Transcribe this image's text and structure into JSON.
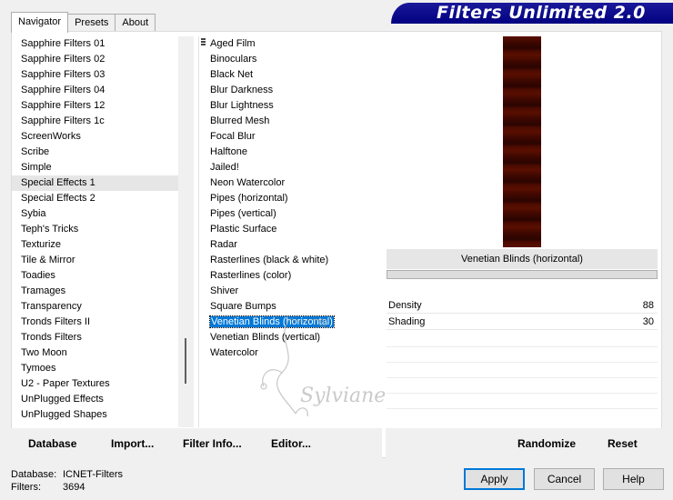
{
  "tabs": [
    {
      "label": "Navigator",
      "active": true
    },
    {
      "label": "Presets",
      "active": false
    },
    {
      "label": "About",
      "active": false
    }
  ],
  "app_title": "Filters Unlimited 2.0",
  "categories": {
    "selected": "Special Effects 1",
    "items": [
      "Sapphire Filters 01",
      "Sapphire Filters 02",
      "Sapphire Filters 03",
      "Sapphire Filters 04",
      "Sapphire Filters 12",
      "Sapphire Filters 1c",
      "ScreenWorks",
      "Scribe",
      "Simple",
      "Special Effects 1",
      "Special Effects 2",
      "Sybia",
      "Teph's Tricks",
      "Texturize",
      "Tile & Mirror",
      "Toadies",
      "Tramages",
      "Transparency",
      "Tronds Filters II",
      "Tronds Filters",
      "Two Moon",
      "Tymoes",
      "U2 - Paper Textures",
      "UnPlugged Effects",
      "UnPlugged Shapes"
    ]
  },
  "filters": {
    "selected": "Venetian Blinds (horizontal)",
    "items": [
      "Aged Film",
      "Binoculars",
      "Black Net",
      "Blur Darkness",
      "Blur Lightness",
      "Blurred Mesh",
      "Focal Blur",
      "Halftone",
      "Jailed!",
      "Neon Watercolor",
      "Pipes (horizontal)",
      "Pipes (vertical)",
      "Plastic Surface",
      "Radar",
      "Rasterlines (black & white)",
      "Rasterlines (color)",
      "Shiver",
      "Square Bumps",
      "Venetian Blinds (horizontal)",
      "Venetian Blinds (vertical)",
      "Watercolor"
    ]
  },
  "preview": {
    "filter_name": "Venetian Blinds (horizontal)",
    "colors": {
      "dark": "#2a0400",
      "light": "#5a0f00"
    }
  },
  "params": [
    {
      "label": "Density",
      "value": "88"
    },
    {
      "label": "Shading",
      "value": "30"
    }
  ],
  "toolbar": {
    "database": "Database",
    "import": "Import...",
    "filter_info": "Filter Info...",
    "editor": "Editor...",
    "randomize": "Randomize",
    "reset": "Reset"
  },
  "footer": {
    "database_label": "Database:",
    "database_value": "ICNET-Filters",
    "filters_label": "Filters:",
    "filters_value": "3694"
  },
  "buttons": {
    "apply": "Apply",
    "cancel": "Cancel",
    "help": "Help"
  },
  "watermark_text": "Sylviane"
}
